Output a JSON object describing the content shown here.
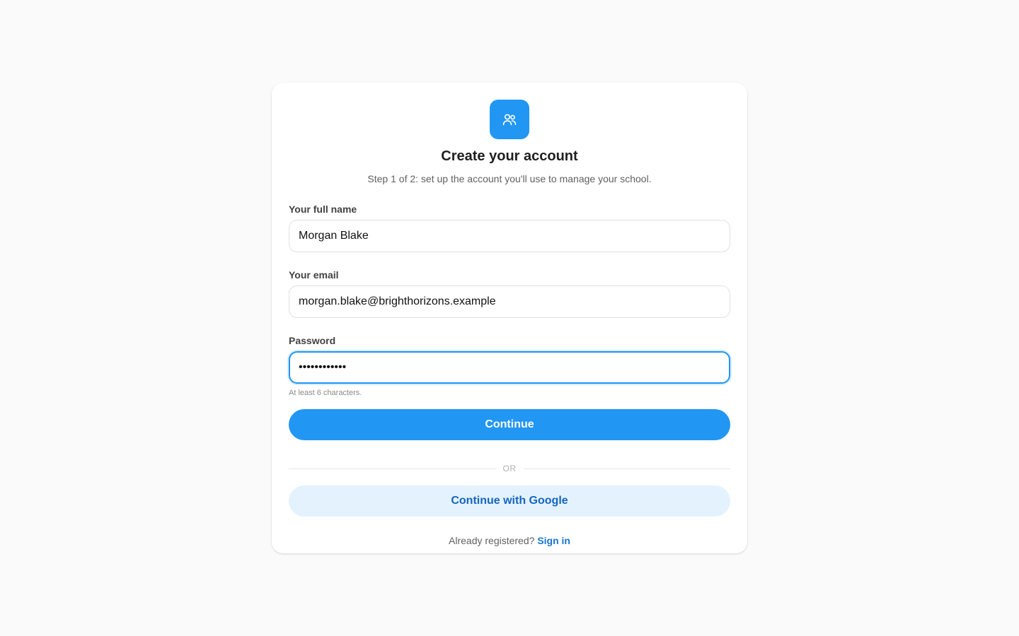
{
  "brand": {
    "icon": "users-icon",
    "color": "#2196f3"
  },
  "header": {
    "title": "Create your account",
    "subtitle": "Step 1 of 2: set up the account you'll use to manage your school."
  },
  "form": {
    "name_label": "Your full name",
    "name_value": "Morgan Blake",
    "email_label": "Your email",
    "email_value": "morgan.blake@brighthorizons.example",
    "password_label": "Password",
    "password_value": "************",
    "password_hint": "At least 6 characters."
  },
  "actions": {
    "continue_label": "Continue",
    "divider_text": "OR",
    "google_label": "Continue with Google"
  },
  "footer": {
    "prompt": "Already registered?",
    "signin_label": "Sign in"
  },
  "colors": {
    "accent": "#2196f3",
    "google_bg": "#e3f2fd",
    "google_text": "#1565c0",
    "link": "#1976d2"
  }
}
